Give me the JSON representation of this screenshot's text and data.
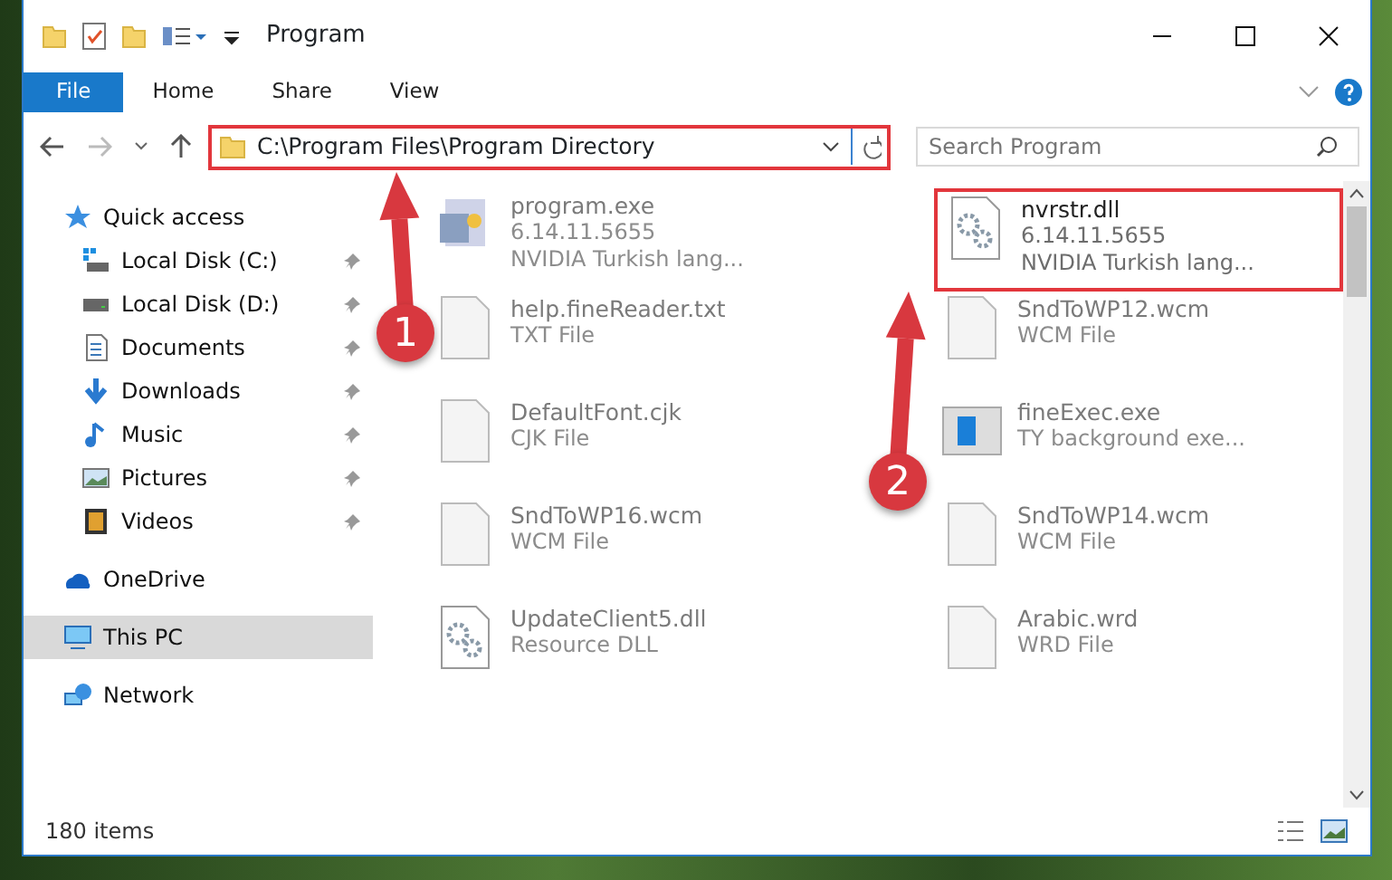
{
  "window": {
    "title": "Program"
  },
  "ribbon_tabs": [
    {
      "label": "File",
      "selected": true
    },
    {
      "label": "Home",
      "selected": false
    },
    {
      "label": "Share",
      "selected": false
    },
    {
      "label": "View",
      "selected": false
    }
  ],
  "address": {
    "path": "C:\\Program Files\\Program Directory",
    "highlighted": true
  },
  "search": {
    "placeholder": "Search Program"
  },
  "sidebar": {
    "items": [
      {
        "label": "Quick access",
        "kind": "star",
        "selected": false,
        "children": [
          {
            "label": "Local Disk (C:)",
            "kind": "drive-c",
            "pinned": true,
            "selected": false
          },
          {
            "label": "Local Disk (D:)",
            "kind": "drive",
            "pinned": true,
            "selected": false
          },
          {
            "label": "Documents",
            "kind": "document",
            "pinned": true,
            "selected": false
          },
          {
            "label": "Downloads",
            "kind": "download",
            "pinned": true,
            "selected": false
          },
          {
            "label": "Music",
            "kind": "music",
            "pinned": true,
            "selected": false
          },
          {
            "label": "Pictures",
            "kind": "picture",
            "pinned": true,
            "selected": false
          },
          {
            "label": "Videos",
            "kind": "video",
            "pinned": true,
            "selected": false
          }
        ]
      },
      {
        "label": "OneDrive",
        "kind": "cloud",
        "selected": false
      },
      {
        "label": "This PC",
        "kind": "pc",
        "selected": true
      },
      {
        "label": "Network",
        "kind": "network",
        "selected": false
      }
    ]
  },
  "files": [
    {
      "name": "program.exe",
      "details": [
        "6.14.11.5655",
        "NVIDIA Turkish lang..."
      ],
      "kind": "exe",
      "blurred": true,
      "highlighted": false
    },
    {
      "name": "nvrstr.dll",
      "details": [
        "6.14.11.5655",
        "NVIDIA Turkish lang..."
      ],
      "kind": "dll",
      "blurred": false,
      "highlighted": true
    },
    {
      "name": "help.fineReader.txt",
      "details": [
        "TXT File"
      ],
      "kind": "page",
      "blurred": true,
      "highlighted": false
    },
    {
      "name": "SndToWP12.wcm",
      "details": [
        "WCM File"
      ],
      "kind": "page",
      "blurred": true,
      "highlighted": false
    },
    {
      "name": "DefaultFont.cjk",
      "details": [
        "CJK File"
      ],
      "kind": "page",
      "blurred": true,
      "highlighted": false
    },
    {
      "name": "fineExec.exe",
      "details": [
        "TY background exe..."
      ],
      "kind": "app",
      "blurred": true,
      "highlighted": false
    },
    {
      "name": "SndToWP16.wcm",
      "details": [
        "WCM File"
      ],
      "kind": "page",
      "blurred": true,
      "highlighted": false
    },
    {
      "name": "SndToWP14.wcm",
      "details": [
        "WCM File"
      ],
      "kind": "page",
      "blurred": true,
      "highlighted": false
    },
    {
      "name": "UpdateClient5.dll",
      "details": [
        "Resource DLL"
      ],
      "kind": "dll",
      "blurred": true,
      "highlighted": false
    },
    {
      "name": "Arabic.wrd",
      "details": [
        "WRD File"
      ],
      "kind": "page",
      "blurred": true,
      "highlighted": false
    }
  ],
  "callouts": [
    {
      "number": "1"
    },
    {
      "number": "2"
    }
  ],
  "status_bar": {
    "count": "180 items"
  }
}
